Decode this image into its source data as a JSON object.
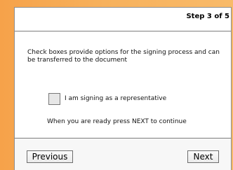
{
  "header": {
    "step_label": "Step 3 of 5"
  },
  "content": {
    "description": "Check boxes provide options for the signing process and can be transferred to the document",
    "checkbox_label": "I am signing as a representative",
    "instruction": "When you are ready press NEXT to continue"
  },
  "footer": {
    "previous_label": "Previous",
    "next_label": "Next"
  },
  "colors": {
    "background_orange": "#f6a24a",
    "dialog_background": "#ffffff",
    "border_gray": "#7d7d7d",
    "checkbox_fill": "#e7e7e7"
  }
}
